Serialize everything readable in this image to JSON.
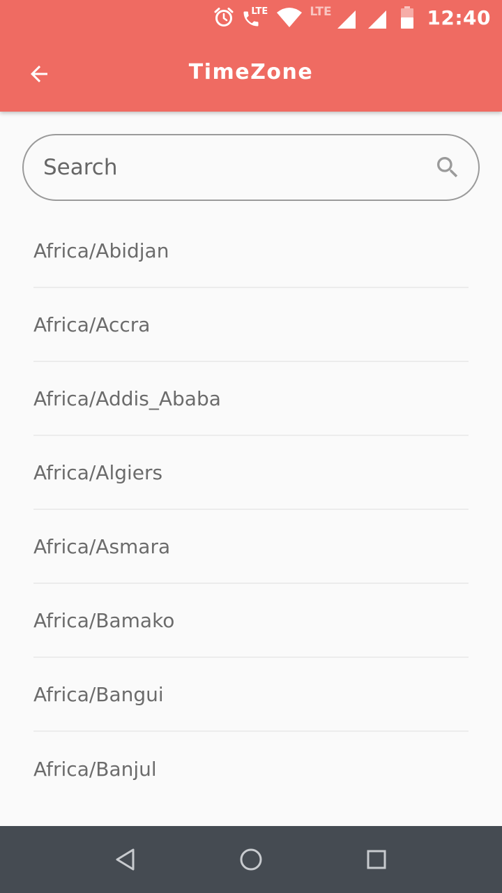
{
  "status_bar": {
    "lte_call": "LTE",
    "lte_data": "LTE",
    "time": "12:40"
  },
  "app_bar": {
    "title": "TimeZone",
    "background_color": "#ef6b62"
  },
  "search": {
    "placeholder": "Search",
    "value": ""
  },
  "timezones": [
    "Africa/Abidjan",
    "Africa/Accra",
    "Africa/Addis_Ababa",
    "Africa/Algiers",
    "Africa/Asmara",
    "Africa/Bamako",
    "Africa/Bangui",
    "Africa/Banjul"
  ],
  "nav_bar": {
    "icons": [
      "back-triangle-icon",
      "home-circle-icon",
      "recents-square-icon"
    ]
  }
}
